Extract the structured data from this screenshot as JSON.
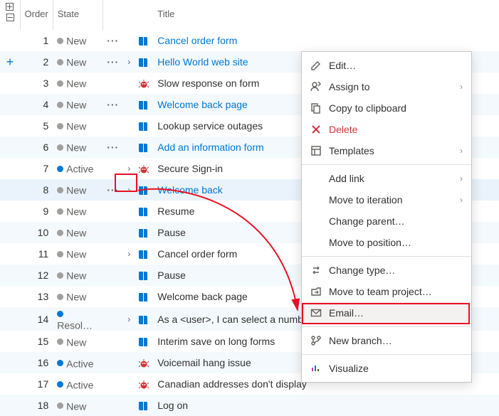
{
  "columns": {
    "order": "Order",
    "state": "State",
    "title": "Title"
  },
  "rows": [
    {
      "order": 1,
      "state": "New",
      "dot": "grey",
      "more": true,
      "expand": false,
      "icon": "book",
      "title": "Cancel order form",
      "link": true,
      "alt": false
    },
    {
      "order": 2,
      "state": "New",
      "dot": "grey",
      "more": true,
      "expand": true,
      "icon": "book",
      "title": "Hello World web site",
      "link": true,
      "alt": true,
      "add": true
    },
    {
      "order": 3,
      "state": "New",
      "dot": "grey",
      "more": false,
      "expand": false,
      "icon": "bug",
      "title": "Slow response on form",
      "link": false,
      "alt": false
    },
    {
      "order": 4,
      "state": "New",
      "dot": "grey",
      "more": true,
      "expand": false,
      "icon": "book",
      "title": "Welcome back page",
      "link": true,
      "alt": true
    },
    {
      "order": 5,
      "state": "New",
      "dot": "grey",
      "more": false,
      "expand": false,
      "icon": "book",
      "title": "Lookup service outages",
      "link": false,
      "alt": false
    },
    {
      "order": 6,
      "state": "New",
      "dot": "grey",
      "more": true,
      "expand": false,
      "icon": "book",
      "title": "Add an information form",
      "link": true,
      "alt": true
    },
    {
      "order": 7,
      "state": "Active",
      "dot": "blue",
      "more": false,
      "expand": true,
      "icon": "bug",
      "title": "Secure Sign-in",
      "link": false,
      "alt": false
    },
    {
      "order": 8,
      "state": "New",
      "dot": "grey",
      "more": true,
      "expand": true,
      "icon": "book",
      "title": "Welcome back",
      "link": true,
      "alt": true,
      "hover": true
    },
    {
      "order": 9,
      "state": "New",
      "dot": "grey",
      "more": false,
      "expand": false,
      "icon": "book",
      "title": "Resume",
      "link": false,
      "alt": false
    },
    {
      "order": 10,
      "state": "New",
      "dot": "grey",
      "more": false,
      "expand": false,
      "icon": "book",
      "title": "Pause",
      "link": false,
      "alt": true
    },
    {
      "order": 11,
      "state": "New",
      "dot": "grey",
      "more": false,
      "expand": true,
      "icon": "book",
      "title": "Cancel order form",
      "link": false,
      "alt": false
    },
    {
      "order": 12,
      "state": "New",
      "dot": "grey",
      "more": false,
      "expand": false,
      "icon": "book",
      "title": "Pause",
      "link": false,
      "alt": true
    },
    {
      "order": 13,
      "state": "New",
      "dot": "grey",
      "more": false,
      "expand": false,
      "icon": "book",
      "title": "Welcome back page",
      "link": false,
      "alt": false
    },
    {
      "order": 14,
      "state": "Resol…",
      "dot": "blue",
      "more": false,
      "expand": true,
      "icon": "book",
      "title": "As a <user>, I can select a numbe",
      "link": false,
      "alt": true
    },
    {
      "order": 15,
      "state": "New",
      "dot": "grey",
      "more": false,
      "expand": false,
      "icon": "book",
      "title": "Interim save on long forms",
      "link": false,
      "alt": false
    },
    {
      "order": 16,
      "state": "Active",
      "dot": "blue",
      "more": false,
      "expand": false,
      "icon": "bug",
      "title": "Voicemail hang issue",
      "link": false,
      "alt": true
    },
    {
      "order": 17,
      "state": "Active",
      "dot": "blue",
      "more": false,
      "expand": false,
      "icon": "bug",
      "title": "Canadian addresses don't display",
      "link": false,
      "alt": false
    },
    {
      "order": 18,
      "state": "New",
      "dot": "grey",
      "more": false,
      "expand": false,
      "icon": "book",
      "title": "Log on",
      "link": false,
      "alt": true
    }
  ],
  "menu": [
    {
      "icon": "edit",
      "label": "Edit…"
    },
    {
      "icon": "assign",
      "label": "Assign to",
      "submenu": true
    },
    {
      "icon": "copy",
      "label": "Copy to clipboard"
    },
    {
      "icon": "delete",
      "label": "Delete",
      "color": "#d13438"
    },
    {
      "icon": "templates",
      "label": "Templates",
      "submenu": true
    },
    {
      "sep": true
    },
    {
      "icon": "",
      "label": "Add link",
      "submenu": true
    },
    {
      "icon": "",
      "label": "Move to iteration",
      "submenu": true
    },
    {
      "icon": "",
      "label": "Change parent…"
    },
    {
      "icon": "",
      "label": "Move to position…"
    },
    {
      "sep": true
    },
    {
      "icon": "changetype",
      "label": "Change type…"
    },
    {
      "icon": "moveteam",
      "label": "Move to team project…"
    },
    {
      "icon": "email",
      "label": "Email…",
      "highlight": true
    },
    {
      "sep": true
    },
    {
      "icon": "branch",
      "label": "New branch…"
    },
    {
      "sep": true
    },
    {
      "icon": "visualize",
      "label": "Visualize"
    }
  ]
}
